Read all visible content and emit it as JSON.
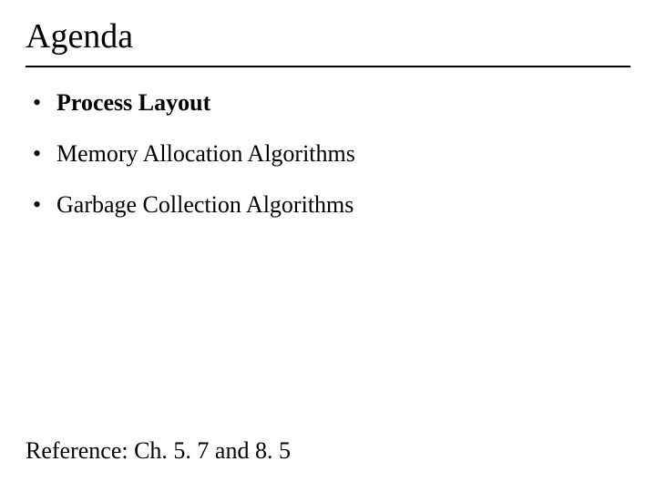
{
  "title": "Agenda",
  "bullets": [
    {
      "text": "Process Layout",
      "bold": true
    },
    {
      "text": "Memory Allocation Algorithms",
      "bold": false
    },
    {
      "text": "Garbage Collection Algorithms",
      "bold": false
    }
  ],
  "reference": "Reference: Ch. 5. 7 and 8. 5"
}
